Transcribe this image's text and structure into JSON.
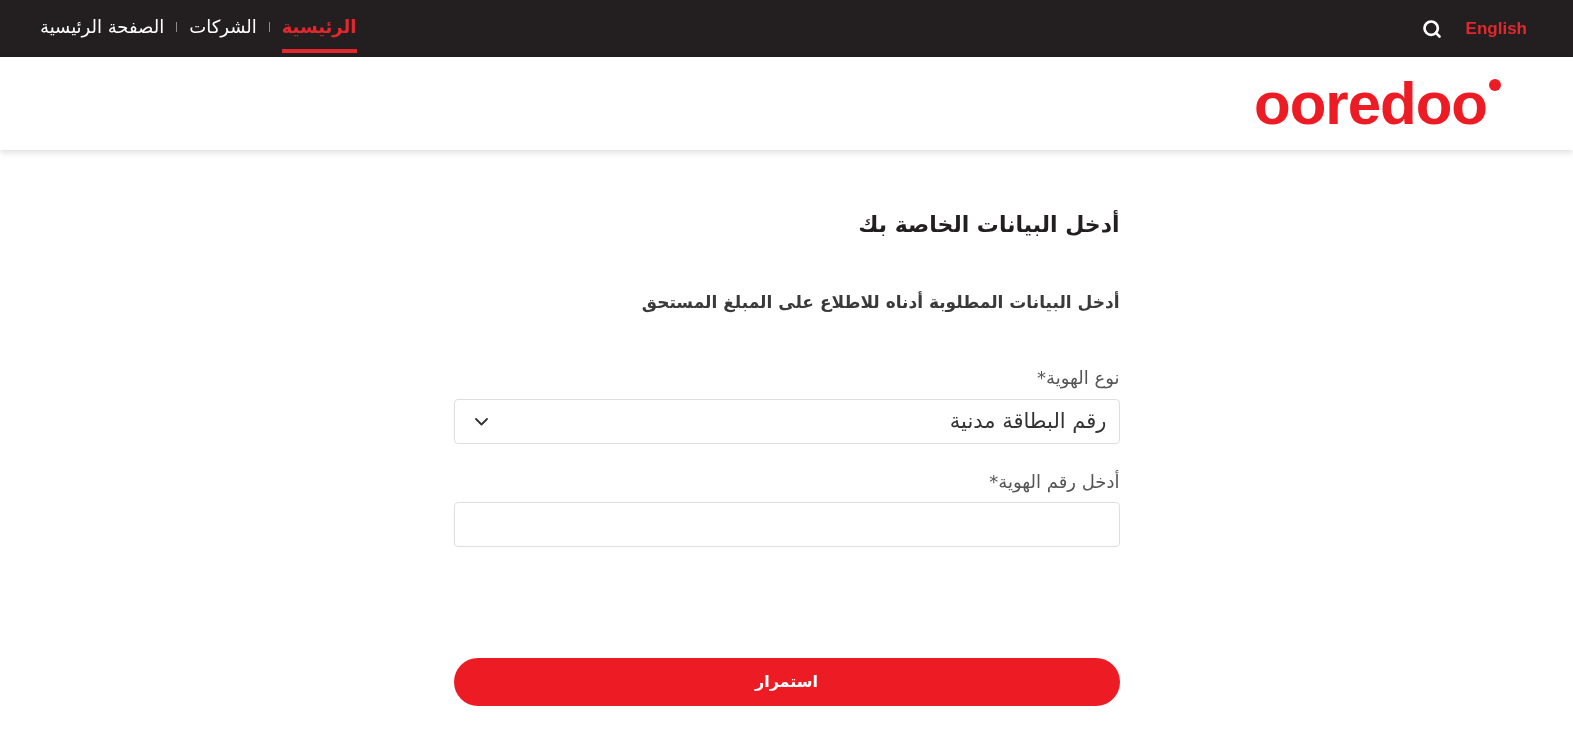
{
  "top_bar": {
    "nav": [
      {
        "label": "الرئيسية",
        "selected": true
      },
      {
        "label": "الشركات",
        "selected": false
      },
      {
        "label": "الصفحة الرئيسية",
        "selected": false
      }
    ],
    "language_link": "English"
  },
  "header": {
    "logo": "ooredoo"
  },
  "form": {
    "title": "أدخل البيانات الخاصة بك",
    "subtitle": "أدخل البيانات المطلوبة أدناه للاطلاع على المبلغ المستحق",
    "fields": [
      {
        "kind": "select",
        "label": "نوع الهوية*",
        "value": "رقم البطاقة مدنية"
      },
      {
        "kind": "text",
        "label": "أدخل رقم الهوية*"
      }
    ],
    "submit_button": "استمرار"
  }
}
